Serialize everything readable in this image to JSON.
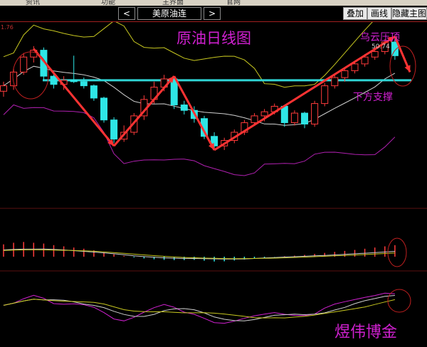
{
  "topbar": {
    "items": [
      "资讯",
      "功能",
      "主界面",
      "官网"
    ]
  },
  "toolbar": {
    "prev_label": "<",
    "instrument": "美原油连",
    "next_label": ">",
    "overlay_label": "叠加",
    "draw_label": "画线",
    "hide_label": "隐藏主图"
  },
  "colors": {
    "up": "#ff3b3b",
    "down": "#2ee6e6",
    "support": "#2fd6d6",
    "boll_upper": "#c8c820",
    "boll_mid": "#d0d0d0",
    "boll_lower": "#b020b0",
    "arrow": "#ff3333",
    "annotation": "#d020d0"
  },
  "chart_data": [
    {
      "type": "candlestick",
      "title": "原油日线图",
      "price_label_top": "1.76",
      "annotations": [
        "乌云压顶",
        "下方支撑",
        "50.74"
      ],
      "support_level": 49.0,
      "ylim": [
        40,
        53
      ],
      "candles": [
        {
          "o": 48.2,
          "h": 48.9,
          "l": 47.8,
          "c": 48.6
        },
        {
          "o": 48.6,
          "h": 49.9,
          "l": 48.3,
          "c": 49.6
        },
        {
          "o": 49.6,
          "h": 51.0,
          "l": 49.4,
          "c": 50.7
        },
        {
          "o": 50.7,
          "h": 51.5,
          "l": 50.3,
          "c": 51.2
        },
        {
          "o": 51.2,
          "h": 51.4,
          "l": 49.0,
          "c": 49.3
        },
        {
          "o": 49.3,
          "h": 49.6,
          "l": 48.4,
          "c": 48.7
        },
        {
          "o": 48.7,
          "h": 49.3,
          "l": 48.3,
          "c": 49.0
        },
        {
          "o": 49.0,
          "h": 50.8,
          "l": 48.8,
          "c": 48.9
        },
        {
          "o": 48.9,
          "h": 49.2,
          "l": 48.4,
          "c": 48.6
        },
        {
          "o": 48.6,
          "h": 48.7,
          "l": 47.5,
          "c": 47.7
        },
        {
          "o": 47.7,
          "h": 47.8,
          "l": 45.9,
          "c": 46.1
        },
        {
          "o": 46.1,
          "h": 46.3,
          "l": 44.4,
          "c": 44.7
        },
        {
          "o": 44.7,
          "h": 45.7,
          "l": 44.5,
          "c": 45.2
        },
        {
          "o": 45.2,
          "h": 46.6,
          "l": 45.0,
          "c": 46.4
        },
        {
          "o": 46.4,
          "h": 47.9,
          "l": 46.1,
          "c": 47.6
        },
        {
          "o": 47.6,
          "h": 48.9,
          "l": 47.3,
          "c": 48.5
        },
        {
          "o": 48.5,
          "h": 49.4,
          "l": 48.2,
          "c": 49.1
        },
        {
          "o": 49.1,
          "h": 49.3,
          "l": 46.9,
          "c": 47.2
        },
        {
          "o": 47.2,
          "h": 47.5,
          "l": 46.5,
          "c": 46.8
        },
        {
          "o": 46.8,
          "h": 47.1,
          "l": 45.9,
          "c": 46.2
        },
        {
          "o": 46.2,
          "h": 46.4,
          "l": 44.7,
          "c": 44.9
        },
        {
          "o": 44.9,
          "h": 45.2,
          "l": 44.0,
          "c": 44.2
        },
        {
          "o": 44.2,
          "h": 44.8,
          "l": 43.9,
          "c": 44.6
        },
        {
          "o": 44.6,
          "h": 45.4,
          "l": 44.4,
          "c": 45.2
        },
        {
          "o": 45.2,
          "h": 46.1,
          "l": 45.0,
          "c": 45.9
        },
        {
          "o": 45.9,
          "h": 46.6,
          "l": 45.7,
          "c": 46.4
        },
        {
          "o": 46.4,
          "h": 46.9,
          "l": 46.0,
          "c": 46.7
        },
        {
          "o": 46.7,
          "h": 47.3,
          "l": 46.5,
          "c": 47.1
        },
        {
          "o": 47.1,
          "h": 47.2,
          "l": 45.6,
          "c": 45.9
        },
        {
          "o": 45.9,
          "h": 46.8,
          "l": 45.7,
          "c": 46.6
        },
        {
          "o": 46.6,
          "h": 46.7,
          "l": 45.5,
          "c": 45.8
        },
        {
          "o": 45.8,
          "h": 47.5,
          "l": 45.6,
          "c": 47.3
        },
        {
          "o": 47.3,
          "h": 48.8,
          "l": 47.1,
          "c": 48.6
        },
        {
          "o": 48.6,
          "h": 49.4,
          "l": 48.4,
          "c": 49.2
        },
        {
          "o": 49.2,
          "h": 49.9,
          "l": 48.9,
          "c": 49.7
        },
        {
          "o": 49.7,
          "h": 50.4,
          "l": 49.5,
          "c": 50.2
        },
        {
          "o": 50.2,
          "h": 50.9,
          "l": 50.0,
          "c": 50.7
        },
        {
          "o": 50.7,
          "h": 51.4,
          "l": 50.5,
          "c": 51.1
        },
        {
          "o": 51.1,
          "h": 52.0,
          "l": 50.9,
          "c": 51.8
        },
        {
          "o": 51.8,
          "h": 52.2,
          "l": 50.5,
          "c": 50.8
        }
      ]
    },
    {
      "type": "bar",
      "name": "volume-panel",
      "ylim": [
        -1,
        1
      ],
      "values": [
        0.62,
        0.7,
        0.74,
        0.7,
        0.66,
        0.58,
        0.52,
        0.46,
        0.4,
        0.32,
        0.22,
        0.12,
        0.04,
        -0.04,
        -0.09,
        -0.13,
        -0.16,
        -0.17,
        -0.17,
        -0.16,
        -0.2,
        -0.24,
        -0.23,
        -0.19,
        -0.14,
        -0.1,
        -0.05,
        -0.01,
        0.02,
        0.05,
        0.09,
        0.14,
        0.19,
        0.24,
        0.29,
        0.34,
        0.4,
        0.46,
        0.52,
        0.58
      ]
    }
  ],
  "brand": {
    "name": "煜伟博金"
  }
}
